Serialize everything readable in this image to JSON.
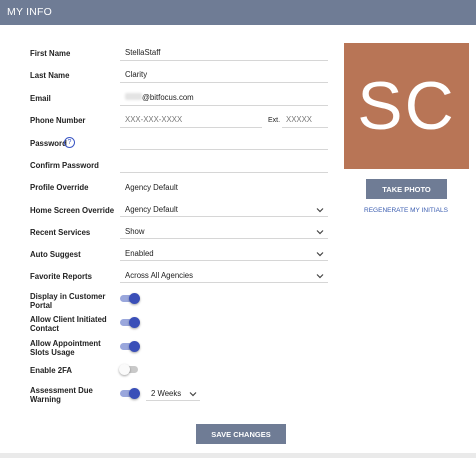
{
  "header": {
    "title": "MY INFO"
  },
  "form": {
    "first_name": {
      "label": "First Name",
      "value": "StellaStaff"
    },
    "last_name": {
      "label": "Last Name",
      "value": "Clarity"
    },
    "email": {
      "label": "Email",
      "value": "@bitfocus.com"
    },
    "phone": {
      "label": "Phone Number",
      "placeholder": "XXX-XXX-XXXX",
      "ext_label": "Ext.",
      "ext_placeholder": "XXXXX"
    },
    "password": {
      "label": "Password",
      "info_glyph": "?"
    },
    "confirm_password": {
      "label": "Confirm Password"
    },
    "profile_override": {
      "label": "Profile Override",
      "value": "Agency Default"
    },
    "home_screen_override": {
      "label": "Home Screen Override",
      "value": "Agency Default"
    },
    "recent_services": {
      "label": "Recent Services",
      "value": "Show"
    },
    "auto_suggest": {
      "label": "Auto Suggest",
      "value": "Enabled"
    },
    "favorite_reports": {
      "label": "Favorite Reports",
      "value": "Across All Agencies"
    },
    "display_customer_portal": {
      "label_line1": "Display in Customer",
      "label_line2": "Portal",
      "enabled": true
    },
    "allow_client_contact": {
      "label_line1": "Allow Client Initiated",
      "label_line2": "Contact",
      "enabled": true
    },
    "allow_appointment_slots": {
      "label_line1": "Allow Appointment",
      "label_line2": "Slots Usage",
      "enabled": true
    },
    "enable_2fa": {
      "label": "Enable 2FA",
      "enabled": false
    },
    "assessment_due_warning": {
      "label_line1": "Assessment Due",
      "label_line2": "Warning",
      "enabled": true,
      "value": "2 Weeks"
    }
  },
  "avatar": {
    "initials": "SC",
    "background": "#b87556"
  },
  "actions": {
    "take_photo": "TAKE PHOTO",
    "regenerate_initials": "REGENERATE MY INITIALS",
    "save_changes": "SAVE CHANGES"
  },
  "colors": {
    "header": "#6f7c95",
    "toggle_on": "#3a4fb8",
    "link": "#3b5db0"
  },
  "icons": {
    "dropdown": "chevron-down-icon",
    "info": "help-circle-icon"
  }
}
